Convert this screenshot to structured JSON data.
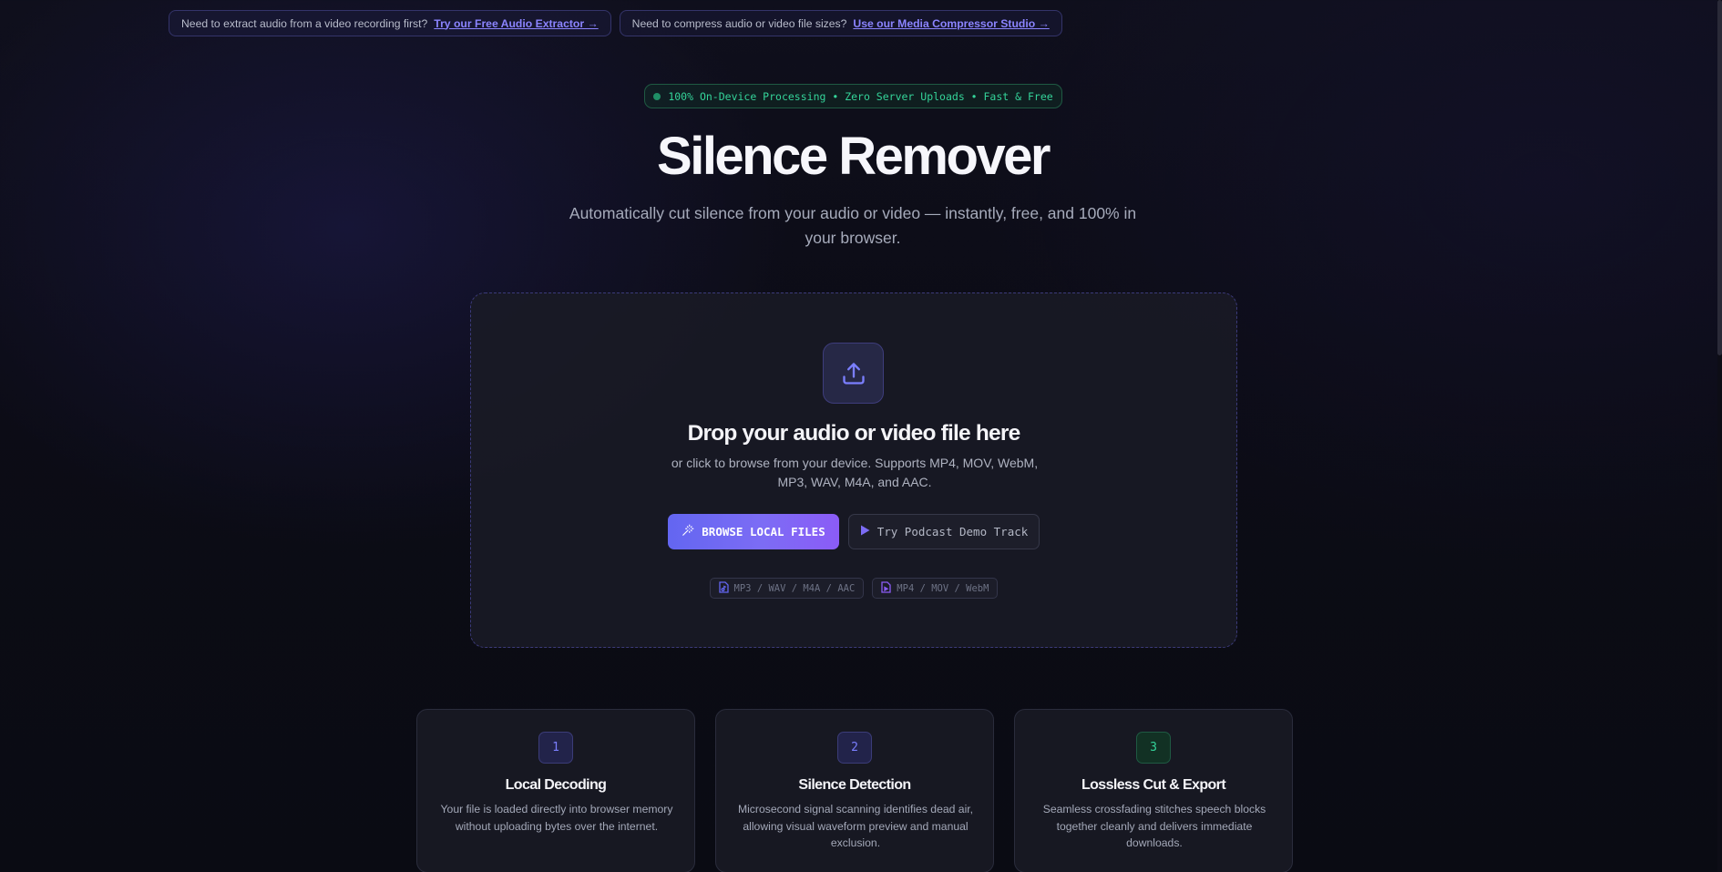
{
  "banners": [
    {
      "text": "Need to extract audio from a video recording first?",
      "link": "Try our Free Audio Extractor →"
    },
    {
      "text": "Need to compress audio or video file sizes?",
      "link": "Use our Media Compressor Studio →"
    }
  ],
  "badge": {
    "text": "100% On-Device Processing • Zero Server Uploads • Fast & Free"
  },
  "hero": {
    "title": "Silence Remover",
    "subtitle": "Automatically cut silence from your audio or video — instantly, free, and 100% in your browser."
  },
  "dropzone": {
    "title": "Drop your audio or video file here",
    "description": "or click to browse from your device. Supports MP4, MOV, WebM, MP3, WAV, M4A, and AAC.",
    "browse_label": "BROWSE LOCAL FILES",
    "demo_label": "Try Podcast Demo Track",
    "formats": [
      {
        "label": "MP3 / WAV / M4A / AAC",
        "icon": "audio-file-icon"
      },
      {
        "label": "MP4 / MOV / WebM",
        "icon": "video-file-icon"
      }
    ]
  },
  "steps": [
    {
      "number": "1",
      "title": "Local Decoding",
      "description": "Your file is loaded directly into browser memory without uploading bytes over the internet."
    },
    {
      "number": "2",
      "title": "Silence Detection",
      "description": "Microsecond signal scanning identifies dead air, allowing visual waveform preview and manual exclusion."
    },
    {
      "number": "3",
      "title": "Lossless Cut & Export",
      "description": "Seamless crossfading stitches speech blocks together cleanly and delivers immediate downloads."
    }
  ],
  "colors": {
    "accent": "#6366f1",
    "accent_end": "#8b5cf6",
    "success": "#34d399",
    "background": "#0c0c16"
  }
}
